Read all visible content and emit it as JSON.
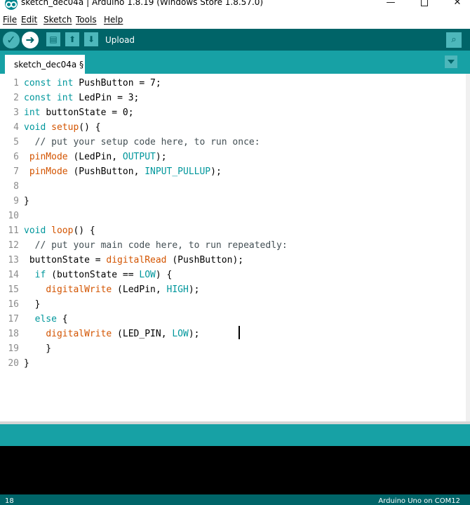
{
  "window": {
    "title": "sketch_dec04a | Arduino 1.8.19 (Windows Store 1.8.57.0)",
    "minimize": "—",
    "close": "✕"
  },
  "menu": {
    "file": "File",
    "edit": "Edit",
    "sketch": "Sketch",
    "tools": "Tools",
    "help": "Help"
  },
  "toolbar": {
    "verify_icon": "check-icon",
    "upload_icon": "arrow-right-icon",
    "new_icon": "new-file-icon",
    "open_icon": "open-arrow-up-icon",
    "save_icon": "save-arrow-down-icon",
    "serial_icon": "magnifier-icon",
    "hover_label": "Upload"
  },
  "tab": {
    "label": "sketch_dec04a §"
  },
  "editor": {
    "lines": [
      {
        "n": "1",
        "code": "const int PushButton = 7;"
      },
      {
        "n": "2",
        "code": "const int LedPin = 3;"
      },
      {
        "n": "3",
        "code": "int buttonState = 0;"
      },
      {
        "n": "4",
        "code": "void setup() {"
      },
      {
        "n": "5",
        "code": "  // put your setup code here, to run once:"
      },
      {
        "n": "6",
        "code": " pinMode (LedPin, OUTPUT);"
      },
      {
        "n": "7",
        "code": " pinMode (PushButton, INPUT_PULLUP);"
      },
      {
        "n": "8",
        "code": ""
      },
      {
        "n": "9",
        "code": "}"
      },
      {
        "n": "10",
        "code": ""
      },
      {
        "n": "11",
        "code": "void loop() {"
      },
      {
        "n": "12",
        "code": "  // put your main code here, to run repeatedly:"
      },
      {
        "n": "13",
        "code": " buttonState = digitalRead (PushButton);"
      },
      {
        "n": "14",
        "code": "  if (buttonState == LOW) {"
      },
      {
        "n": "15",
        "code": "    digitalWrite (LedPin, HIGH);"
      },
      {
        "n": "16",
        "code": "  }"
      },
      {
        "n": "17",
        "code": "  else {"
      },
      {
        "n": "18",
        "code": "    digitalWrite (LED_PIN, LOW);"
      },
      {
        "n": "19",
        "code": "    }"
      },
      {
        "n": "20",
        "code": "}"
      }
    ]
  },
  "status": {
    "line": "18",
    "board": "Arduino Uno on COM12"
  },
  "colors": {
    "toolbar": "#006468",
    "tabstrip": "#17a1a5",
    "keyword": "#00979c",
    "function": "#d35400",
    "console": "#000000"
  }
}
